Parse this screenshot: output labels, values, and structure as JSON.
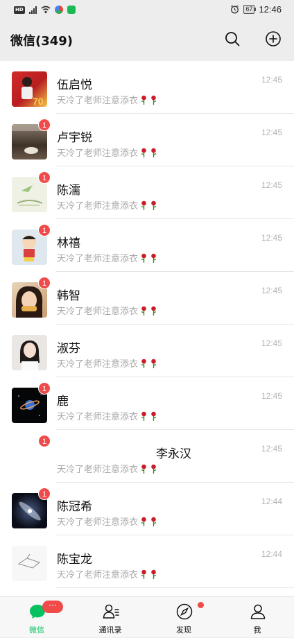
{
  "status_bar": {
    "left_text": "HD",
    "battery": "67",
    "time": "12:46"
  },
  "header": {
    "title": "微信(349)"
  },
  "chats": [
    {
      "name": "伍启悦",
      "message": "天冷了老师注意添衣",
      "time": "12:45",
      "badge": ""
    },
    {
      "name": "卢宇锐",
      "message": "天冷了老师注意添衣",
      "time": "12:45",
      "badge": "1"
    },
    {
      "name": "陈濡",
      "message": "天冷了老师注意添衣",
      "time": "12:45",
      "badge": "1"
    },
    {
      "name": "林禧",
      "message": "天冷了老师注意添衣",
      "time": "12:45",
      "badge": "1"
    },
    {
      "name": "韩智",
      "message": "天冷了老师注意添衣",
      "time": "12:45",
      "badge": "1"
    },
    {
      "name": "淑芬",
      "message": "天冷了老师注意添衣",
      "time": "12:45",
      "badge": ""
    },
    {
      "name": "鹿",
      "message": "天冷了老师注意添衣",
      "time": "12:45",
      "badge": "1"
    },
    {
      "name": "李永汉",
      "message": "天冷了老师注意添衣",
      "time": "12:45",
      "badge": "1"
    },
    {
      "name": "陈冠希",
      "message": "天冷了老师注意添衣",
      "time": "12:44",
      "badge": "1"
    },
    {
      "name": "陈宝龙",
      "message": "天冷了老师注意添衣",
      "time": "12:44",
      "badge": ""
    }
  ],
  "tabs": [
    {
      "label": "微信",
      "badge": "···",
      "icon": "chat-icon"
    },
    {
      "label": "通讯录",
      "icon": "contacts-icon"
    },
    {
      "label": "发现",
      "icon": "compass-icon"
    },
    {
      "label": "我",
      "icon": "person-icon"
    }
  ],
  "colors": {
    "accent": "#07c160",
    "badge": "#f04a4a",
    "background": "#ededed"
  }
}
